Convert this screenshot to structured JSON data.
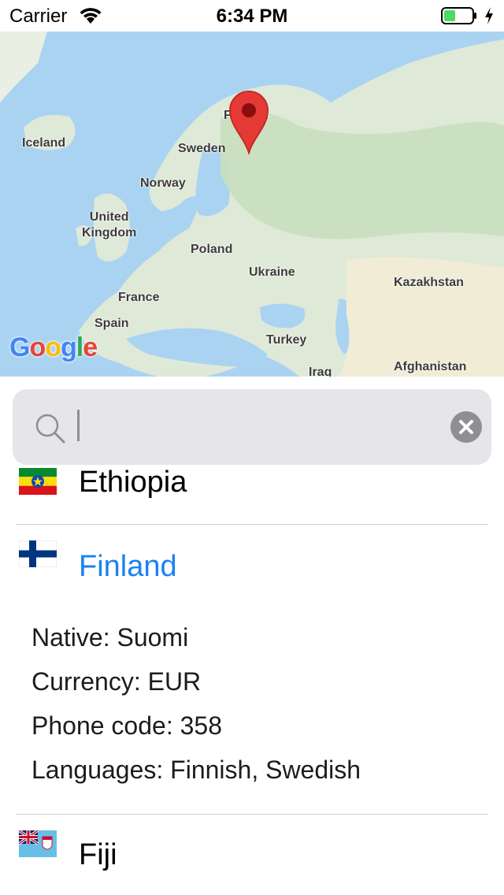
{
  "status_bar": {
    "carrier": "Carrier",
    "time": "6:34 PM"
  },
  "map": {
    "labels": {
      "iceland": "Iceland",
      "sweden": "Sweden",
      "finland": "Finland",
      "norway": "Norway",
      "uk": "United\nKingdom",
      "poland": "Poland",
      "ukraine": "Ukraine",
      "kazakhstan": "Kazakhstan",
      "france": "France",
      "spain": "Spain",
      "turkey": "Turkey",
      "iraq": "Iraq",
      "afghanistan": "Afghanistan"
    },
    "google_logo": "Google"
  },
  "search": {
    "value": "",
    "placeholder": ""
  },
  "countries": {
    "ethiopia": {
      "name": "Ethiopia"
    },
    "finland": {
      "name": "Finland",
      "native": "Native: Suomi",
      "currency": "Currency: EUR",
      "phone": "Phone code: 358",
      "languages": "Languages: Finnish, Swedish"
    },
    "fiji": {
      "name": "Fiji"
    }
  },
  "colors": {
    "selected_text": "#1a82f0",
    "search_bg": "#e5e5ea",
    "pin": "#e53935"
  }
}
